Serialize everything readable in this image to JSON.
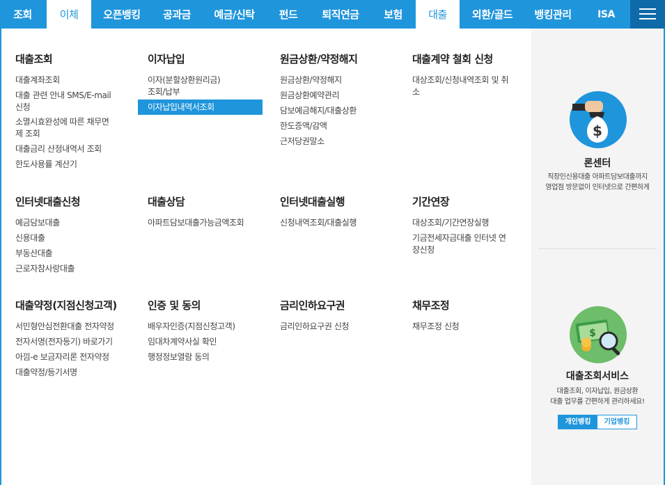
{
  "nav": {
    "tabs": [
      "조회",
      "이체",
      "오픈뱅킹",
      "공과금",
      "예금/신탁",
      "펀드",
      "퇴직연금",
      "보험",
      "대출",
      "외환/골드",
      "뱅킹관리",
      "ISA"
    ]
  },
  "columns": [
    {
      "title": "대출조회",
      "items": [
        "대출계좌조회",
        "대출 관련 안내 SMS/E-mail\n신청",
        "소멸시효완성에 따른 채무면\n제 조회",
        "대출금리 산정내역서 조회",
        "한도사용률 계산기"
      ]
    },
    {
      "title": "이자납입",
      "items": [
        "이자(분할상환원리금)\n조회/납부",
        "이자납입내역서조회"
      ]
    },
    {
      "title": "원금상환/약정해지",
      "items": [
        "원금상환/약정해지",
        "원금상환예약관리",
        "담보예금해지/대출상환",
        "한도증액/감액",
        "근저당권말소"
      ]
    },
    {
      "title": "대출계약 철회 신청",
      "items": [
        "대상조회/신청내역조회 및 취\n소"
      ]
    },
    {
      "title": "인터넷대출신청",
      "items": [
        "예금담보대출",
        "신용대출",
        "부동산대출",
        "근로자참사랑대출"
      ]
    },
    {
      "title": "대출상담",
      "items": [
        "아파트담보대출가능금액조회"
      ]
    },
    {
      "title": "인터넷대출실행",
      "items": [
        "신청내역조회/대출실행"
      ]
    },
    {
      "title": "기간연장",
      "items": [
        "대상조회/기간연장실행",
        "기금전세자금대출 인터넷 연\n장신청"
      ]
    },
    {
      "title": "대출약정(지점신청고객)",
      "items": [
        "서민형안심전환대출 전자약정",
        "전자서명(전자등기) 바로가기",
        "아낌-e 보금자리론 전자약정",
        "대출약정/등기서명"
      ]
    },
    {
      "title": "인증 및 동의",
      "items": [
        "배우자인증(지점신청고객)",
        "임대차계약사실 확인",
        "행정정보열람 동의"
      ]
    },
    {
      "title": "금리인하요구권",
      "items": [
        "금리인하요구권 신청"
      ]
    },
    {
      "title": "채무조정",
      "items": [
        "채무조정 신청"
      ]
    }
  ],
  "side": {
    "loan_center": {
      "title": "론센터",
      "desc1": "직장인신용대출 아파트담보대출까지",
      "desc2": "영업점 방문없이 인터넷으로 간편하게",
      "icon_symbol": "$"
    },
    "inquiry_service": {
      "title": "대출조회서비스",
      "desc1": "대출조회, 이자납입, 원금상환",
      "desc2": "대출 업무를 간편하게 관리하세요!",
      "btn_personal": "개인뱅킹",
      "btn_business": "기업뱅킹",
      "icon_symbol": "$"
    }
  },
  "colors": {
    "accent": "#1f95dc",
    "dark_accent": "#0e6aa8",
    "side_bg": "#f4f4f4"
  }
}
